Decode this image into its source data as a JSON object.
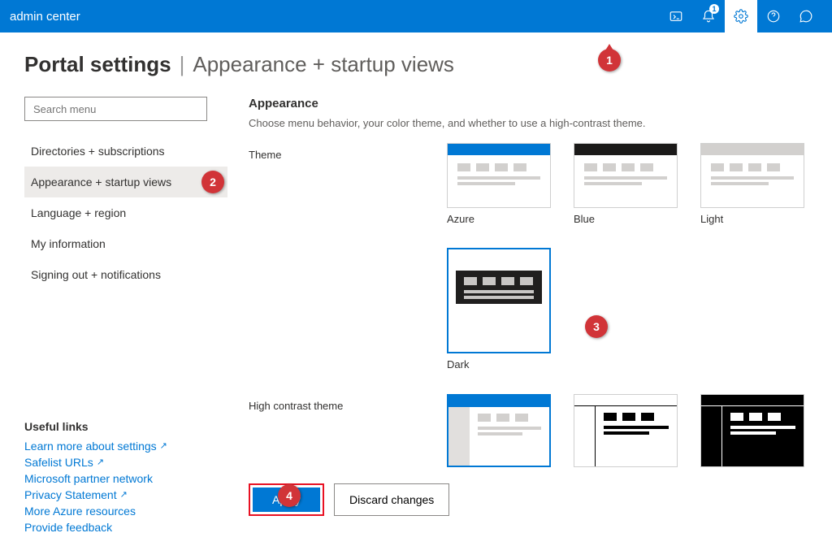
{
  "header": {
    "app_title": "admin center",
    "notification_count": "1"
  },
  "page": {
    "title": "Portal settings",
    "separator": "|",
    "subtitle": "Appearance + startup views"
  },
  "sidebar": {
    "search_placeholder": "Search menu",
    "nav_items": [
      "Directories + subscriptions",
      "Appearance + startup views",
      "Language + region",
      "My information",
      "Signing out + notifications"
    ],
    "useful_links_title": "Useful links",
    "links": [
      "Learn more about settings",
      "Safelist URLs",
      "Microsoft partner network",
      "Privacy Statement",
      "More Azure resources",
      "Provide feedback"
    ]
  },
  "content": {
    "appearance_title": "Appearance",
    "appearance_desc": "Choose menu behavior, your color theme, and whether to use a high-contrast theme.",
    "theme_label": "Theme",
    "themes": [
      {
        "name": "Azure",
        "bar": "#0078d4"
      },
      {
        "name": "Blue",
        "bar": "#1b1a19"
      },
      {
        "name": "Light",
        "bar": "#d2d0ce"
      },
      {
        "name": "Dark"
      }
    ],
    "high_contrast_label": "High contrast theme",
    "buttons": {
      "apply": "Apply",
      "discard": "Discard changes"
    }
  },
  "callouts": [
    "1",
    "2",
    "3",
    "4"
  ]
}
